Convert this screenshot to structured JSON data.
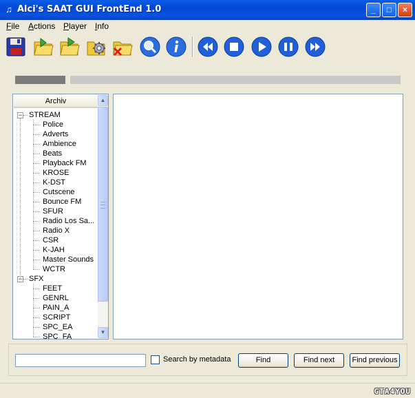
{
  "window": {
    "title": "Alci's SAAT GUI FrontEnd 1.0",
    "controls": {
      "minimize": "_",
      "maximize": "□",
      "close": "×"
    }
  },
  "menu": [
    {
      "label": "File",
      "underline": "F",
      "rest": "ile"
    },
    {
      "label": "Actions",
      "underline": "A",
      "rest": "ctions"
    },
    {
      "label": "Player",
      "underline": "P",
      "rest": "layer"
    },
    {
      "label": "Info",
      "underline": "I",
      "rest": "nfo"
    }
  ],
  "toolbar": {
    "icons": [
      "save-icon",
      "open-folder-green-icon",
      "open-folder-arrow-icon",
      "settings-folder-icon",
      "delete-folder-icon",
      "search-icon",
      "info-icon",
      "rewind-icon",
      "stop-icon",
      "play-icon",
      "pause-icon",
      "fast-forward-icon"
    ],
    "colors": {
      "media": "#1f5fd8",
      "folder": "#f0c838",
      "green": "#3aa83a",
      "red": "#d82020"
    }
  },
  "progress": {
    "value": 0.0
  },
  "tree": {
    "header": "Archiv",
    "groups": [
      {
        "label": "STREAM",
        "expanded": true,
        "children": [
          "Police",
          "Adverts",
          "Ambience",
          "Beats",
          "Playback FM",
          "KROSE",
          "K-DST",
          "Cutscene",
          "Bounce FM",
          "SFUR",
          "Radio Los Sa...",
          "Radio X",
          "CSR",
          "K-JAH",
          "Master Sounds",
          "WCTR"
        ]
      },
      {
        "label": "SFX",
        "expanded": true,
        "children": [
          "FEET",
          "GENRL",
          "PAIN_A",
          "SCRIPT",
          "SPC_EA",
          "SPC_FA"
        ]
      }
    ]
  },
  "search": {
    "input_value": "",
    "checkbox_label": "Search by metadata",
    "checkbox_checked": false,
    "find_label": "Find",
    "find_next_label": "Find next",
    "find_previous_label": "Find previous"
  },
  "watermark": "GTA4YOU"
}
